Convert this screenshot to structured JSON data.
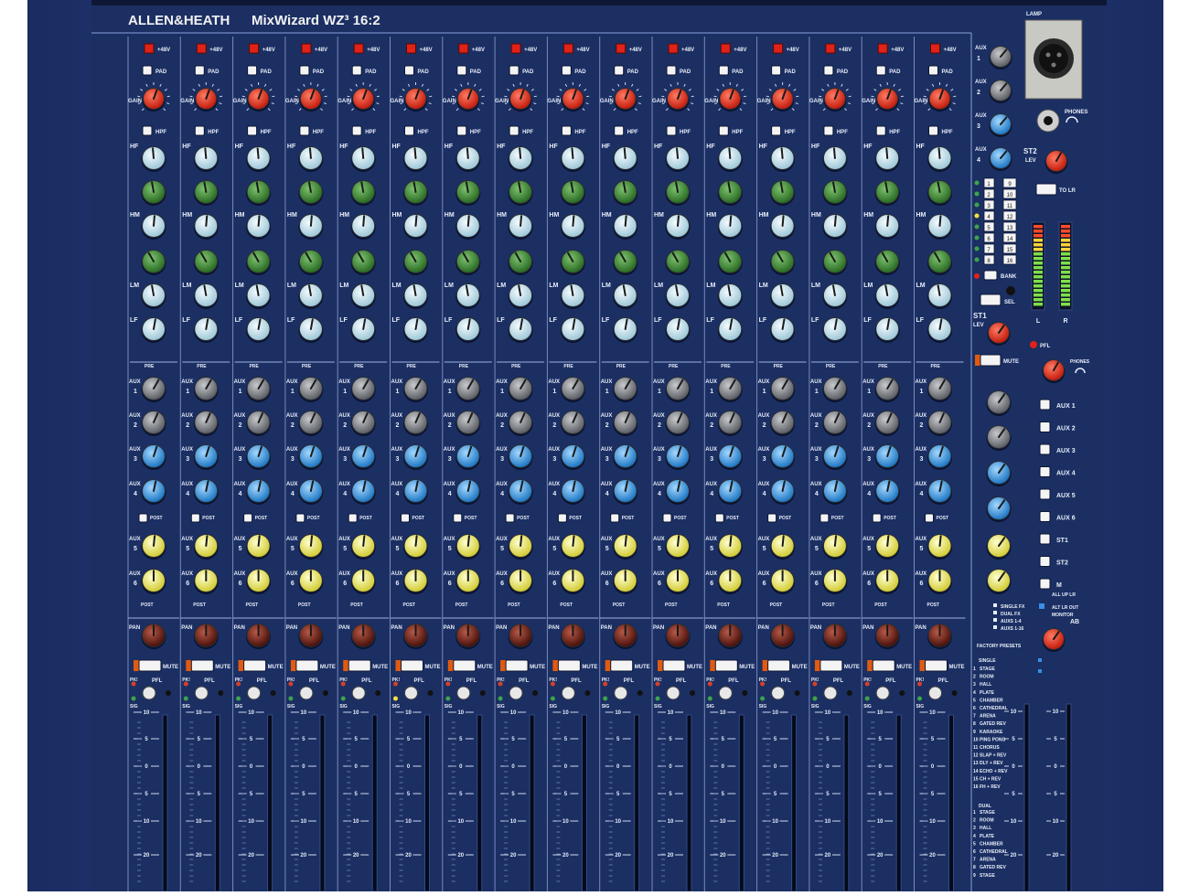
{
  "brand": {
    "maker": "ALLEN&HEATH",
    "model": "MixWizard WZ³ 16:2"
  },
  "channel_count": 16,
  "channel": {
    "phantom_label": "+48V",
    "pad_label": "PAD",
    "gain_label": "GAIN",
    "hpf_label": "HPF",
    "hf_label": "HF",
    "hm_label": "HM",
    "lm_label": "LM",
    "lf_label": "LF",
    "aux_label": "AUX",
    "pre_label": "PRE",
    "post_label": "POST",
    "pan_label": "PAN",
    "mute_label": "MUTE",
    "pfl_label": "PFL",
    "pk_label": "PK!",
    "sig_label": "SIG",
    "fader_scale": [
      "10",
      "5",
      "0",
      "5",
      "10",
      "20"
    ]
  },
  "master": {
    "lamp_label": "LAMP",
    "phones_label": "PHONES",
    "st2_label": "ST2",
    "st2_lev_label": "LEV",
    "to_lr_label": "TO LR",
    "st1_label": "ST1",
    "st1_lev_label": "LEV",
    "mute_label": "MUTE",
    "pfl_label": "PFL",
    "bank_label": "BANK",
    "sel_label": "SEL",
    "meter_l_label": "L",
    "meter_r_label": "R",
    "aux_select": [
      "AUX 1",
      "AUX 2",
      "AUX 3",
      "AUX 4",
      "AUX 5",
      "AUX 6",
      "ST1",
      "ST2",
      "M"
    ],
    "all_up_label": "ALL UP LR",
    "lr_out_label": "ALT LR OUT",
    "monitor_label": "MONITOR",
    "ab_label": "AB",
    "fx_modes": [
      "SINGLE FX",
      "DUAL FX",
      "AUXS 1-4",
      "AUXS 1-16"
    ],
    "preset_numbers": [
      "1",
      "2",
      "3",
      "4",
      "5",
      "6",
      "7",
      "8",
      "9",
      "10",
      "11",
      "12",
      "13",
      "14",
      "15",
      "16"
    ],
    "factory_presets_title": "FACTORY PRESETS",
    "single_title": "SINGLE",
    "dual_title": "DUAL",
    "presets_single": [
      "STAGE",
      "ROOM",
      "HALL",
      "PLATE",
      "CHAMBER",
      "CATHEDRAL",
      "ARENA",
      "GATED REV",
      "KARAOKE",
      "PING PONG",
      "CHORUS",
      "SLAP + REV",
      "DLY + REV",
      "ECHO + REV",
      "CH + REV",
      "FH + REV"
    ],
    "presets_dual": [
      "STAGE",
      "ROOM",
      "HALL",
      "PLATE",
      "CHAMBER",
      "CATHEDRAL",
      "ARENA",
      "GATED REV",
      "STAGE"
    ]
  },
  "colors": {
    "panel": "#1b2f63",
    "frame": "#253f86",
    "gain_knob": "#e0321f",
    "eq_knob": "#cfe6ef",
    "mid_freq_knob": "#3d8b35",
    "aux_grey_knob": "#8a8d92",
    "aux_blue_knob": "#3aa0e0",
    "aux_yellow_knob": "#f1ee6a",
    "pan_knob": "#6e1f18",
    "phantom_led": "#e02218"
  }
}
